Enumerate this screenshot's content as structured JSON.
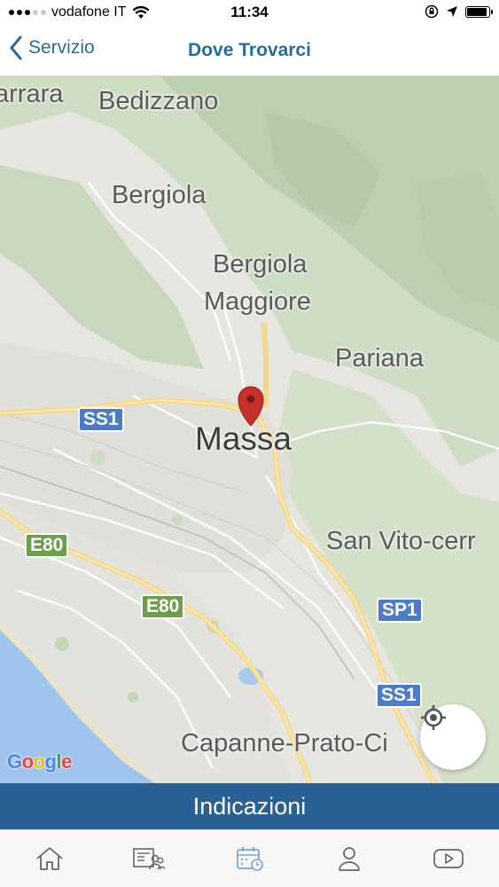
{
  "status_bar": {
    "carrier": "vodafone IT",
    "time": "11:34"
  },
  "nav": {
    "back_label": "Servizio",
    "title": "Dove Trovarci"
  },
  "map": {
    "labels": {
      "carrara": "arrara",
      "bedizzano": "Bedizzano",
      "bergiola": "Bergiola",
      "bergiola_maggiore_1": "Bergiola",
      "bergiola_maggiore_2": "Maggiore",
      "pariana": "Pariana",
      "massa": "Massa",
      "san_vito": "San Vito-cerr",
      "capanne": "Capanne-Prato-Ci"
    },
    "road_badges": {
      "ss1_a": "SS1",
      "e80_a": "E80",
      "e80_b": "E80",
      "sp1": "SP1",
      "ss1_b": "SS1"
    },
    "attribution": {
      "g1": "G",
      "o1": "o",
      "o2": "o",
      "g2": "g",
      "l": "l",
      "e": "e"
    }
  },
  "actions": {
    "directions_label": "Indicazioni"
  },
  "tabs": [
    {
      "icon": "home-icon"
    },
    {
      "icon": "news-people-icon"
    },
    {
      "icon": "calendar-icon",
      "active": true
    },
    {
      "icon": "user-icon"
    },
    {
      "icon": "youtube-icon"
    }
  ],
  "colors": {
    "accent": "#2a6b9a",
    "directions_bg": "#2a6194",
    "pin": "#c8312b",
    "active_tab": "#7aa6cf"
  }
}
